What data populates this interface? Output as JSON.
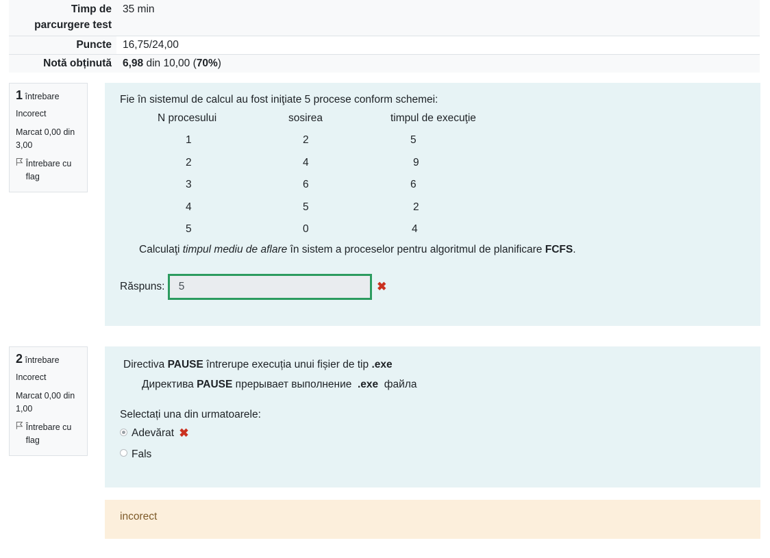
{
  "summary": {
    "time_label": "Timp de parcurgere test",
    "time_value": "35 min",
    "points_label": "Puncte",
    "points_value": "16,75/24,00",
    "grade_label": "Notă obținută",
    "grade_value_bold": "6,98",
    "grade_value_mid": " din 10,00 (",
    "grade_percent": "70%",
    "grade_value_end": ")"
  },
  "q1": {
    "number": "1",
    "word": "întrebare",
    "status": "Incorect",
    "marks": "Marcat 0,00 din 3,00",
    "flag_label": "Întrebare cu flag",
    "intro": "Fie în sistemul de calcul au fost iniţiate  5 procese conform schemei:",
    "headers": [
      "N procesului",
      "sosirea",
      "timpul de execuţie"
    ],
    "rows": [
      [
        "1",
        "2",
        "5"
      ],
      [
        "2",
        "4",
        "9"
      ],
      [
        "3",
        "6",
        "6"
      ],
      [
        "4",
        "5",
        "2"
      ],
      [
        "5",
        "0",
        "4"
      ]
    ],
    "task_pre": "Calculaţi ",
    "task_italic": "timpul mediu de aflare",
    "task_mid": " în sistem a proceselor pentru algoritmul de planificare ",
    "task_bold": "FCFS",
    "task_end": ".",
    "answer_label": "Răspuns:",
    "answer_value": "5"
  },
  "q2": {
    "number": "2",
    "word": "întrebare",
    "status": "Incorect",
    "marks": "Marcat 0,00 din 1,00",
    "flag_label": "Întrebare cu flag",
    "line1_pre": "Directiva ",
    "line1_bold1": "PAUSE",
    "line1_mid": " întrerupe execuția unui fișier de tip ",
    "line1_bold2": ".exe",
    "line2_pre": "Директива ",
    "line2_bold1": "PAUSE",
    "line2_mid": " прерывает выполнение  ",
    "line2_bold2": ".exe",
    "line2_end": "  файла",
    "prompt": "Selectați una din urmatoarele:",
    "option1": "Adevărat",
    "option2": "Fals",
    "feedback": "incorect"
  },
  "colors": {
    "content_bg": "#e7f3f5",
    "feedback_bg": "#fcefdc",
    "correct_border": "#2c9b5f",
    "incorrect_mark": "#ca3120"
  },
  "icons": [
    "flag-icon",
    "cross-icon",
    "radio-icon"
  ]
}
